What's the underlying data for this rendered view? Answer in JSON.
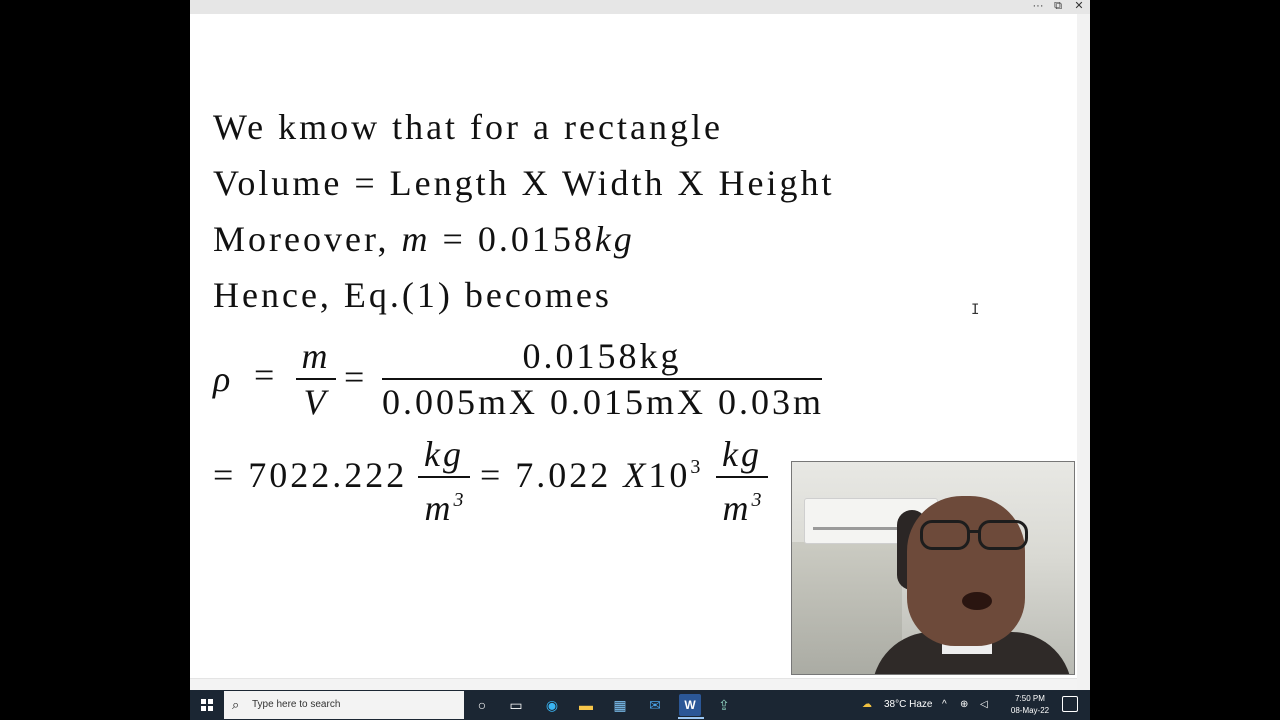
{
  "window": {
    "controls": [
      "···",
      "⧉",
      "✕"
    ]
  },
  "slide": {
    "line1": "We kmow that for a rectangle",
    "line2": "Volume = Length X Width X Height",
    "line3_prefix": "Moreover, ",
    "line3_var": "m",
    "line3_eq": " = 0.0158",
    "line3_unit": "kg",
    "line4": "Hence, Eq.(1) becomes",
    "rho": "ρ",
    "eq1": "=",
    "frac1_num": "m",
    "frac1_den": "V",
    "eq2": "=",
    "frac2_num": "0.0158kg",
    "frac2_den": "0.005mX 0.015mX 0.03m",
    "result_prefix": "= 7022.222",
    "unit_num": "kg",
    "unit_den": "m",
    "unit_exp": "3",
    "result_mid": "= 7.022",
    "result_x": "X",
    "result_base": "10",
    "result_exp": "3",
    "unit2_num": "kg",
    "unit2_den": "m",
    "unit2_exp": "3"
  },
  "cursor": "I",
  "taskbar": {
    "search_placeholder": "Type here to search",
    "icons": [
      "cortana-icon",
      "task-view-icon",
      "edge-icon",
      "file-explorer-icon",
      "store-icon",
      "mail-icon",
      "word-icon",
      "upload-app-icon"
    ],
    "weather": "38°C  Haze",
    "time": "7:50 PM",
    "date": "08-May-22"
  }
}
